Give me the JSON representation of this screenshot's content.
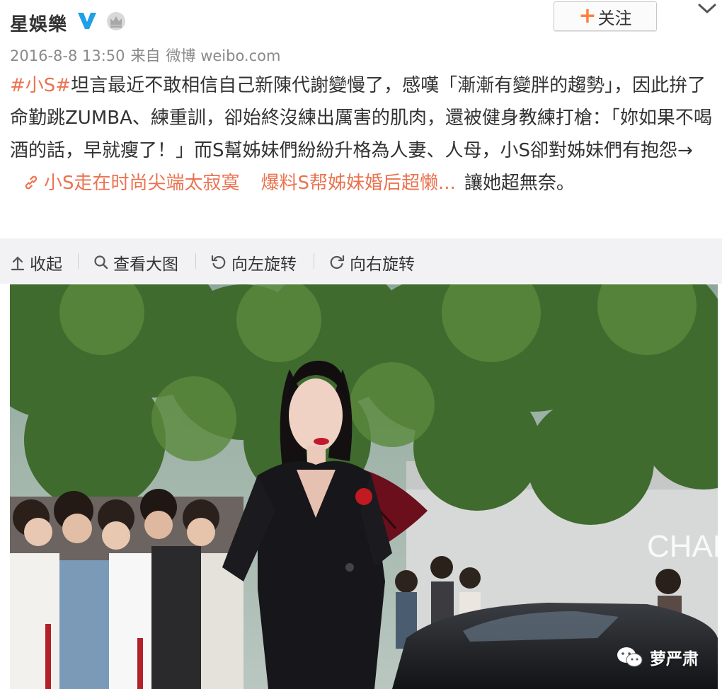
{
  "header": {
    "name": "星娛樂",
    "follow_label": "关注",
    "timestamp": "2016-8-8 13:50",
    "source_prefix": "来自",
    "source": "微博 weibo.com"
  },
  "post": {
    "tag": "#小S#",
    "text_1": "坦言最近不敢相信自己新陳代謝變慢了，感嘆「漸漸有變胖的趨勢」，因此拚了命勤跳ZUMBA、練重訓，卻始終沒練出厲害的肌肉，還被健身教練打槍：「妳如果不喝酒的話，早就瘦了！」而S幫姊妹們紛紛升格為人妻、人母，小S卻對姊妹們有抱怨→",
    "link_1": "小S走在时尚尖端太寂寞",
    "link_2": "爆料S帮姊妹婚后超懒...",
    "text_2": "讓她超無奈。"
  },
  "toolbar": {
    "collapse": "收起",
    "view_large": "查看大图",
    "rotate_left": "向左旋转",
    "rotate_right": "向右旋转"
  },
  "photo": {
    "store_sign": "CHAN",
    "watermark": "萝严肃"
  },
  "colors": {
    "accent": "#eb7350",
    "verified": "#1fa0e8",
    "toolbar_bg": "#f2f2f5"
  },
  "icons": [
    "verified-v-icon",
    "crown-icon",
    "plus-icon",
    "chevron-down-icon",
    "link-icon",
    "collapse-icon",
    "search-icon",
    "rotate-left-icon",
    "rotate-right-icon",
    "wechat-icon"
  ]
}
